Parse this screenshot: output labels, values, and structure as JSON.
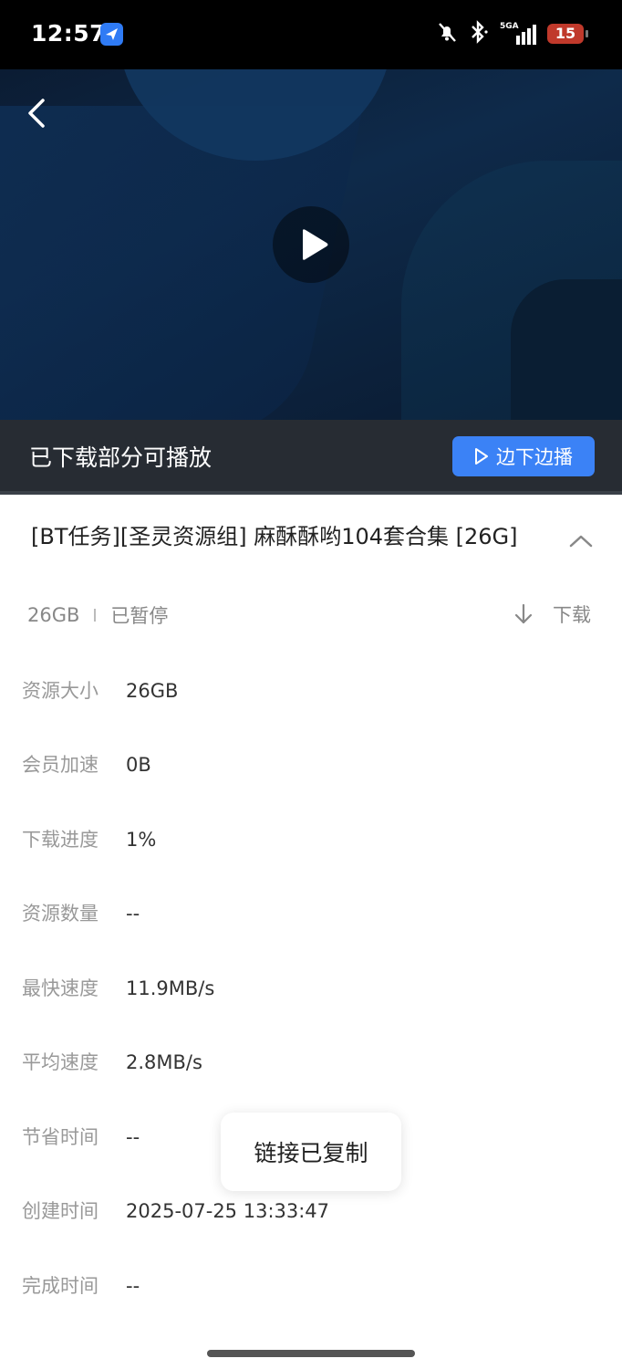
{
  "status_bar": {
    "time": "12:57",
    "network_label": "5GA",
    "battery": "15",
    "icons": [
      "app-notification-icon",
      "mute-icon",
      "bluetooth-icon",
      "signal-icon",
      "battery-icon"
    ]
  },
  "player": {
    "icons": [
      "back-icon",
      "play-icon"
    ],
    "partial_label": "已下载部分可播放",
    "stream_button": "边下边播",
    "accent_color": "#3b82f6"
  },
  "task": {
    "title": "[BT任务][圣灵资源组] 麻酥酥哟104套合集 [26G]",
    "size": "26GB",
    "status": "已暂停",
    "download_label": "下载"
  },
  "details": [
    {
      "label": "资源大小",
      "value": "26GB"
    },
    {
      "label": "会员加速",
      "value": "0B"
    },
    {
      "label": "下载进度",
      "value": "1%"
    },
    {
      "label": "资源数量",
      "value": "--"
    },
    {
      "label": "最快速度",
      "value": "11.9MB/s"
    },
    {
      "label": "平均速度",
      "value": "2.8MB/s"
    },
    {
      "label": "节省时间",
      "value": "--"
    },
    {
      "label": "创建时间",
      "value": "2025-07-25 13:33:47"
    },
    {
      "label": "完成时间",
      "value": "--"
    }
  ],
  "toast": "链接已复制"
}
